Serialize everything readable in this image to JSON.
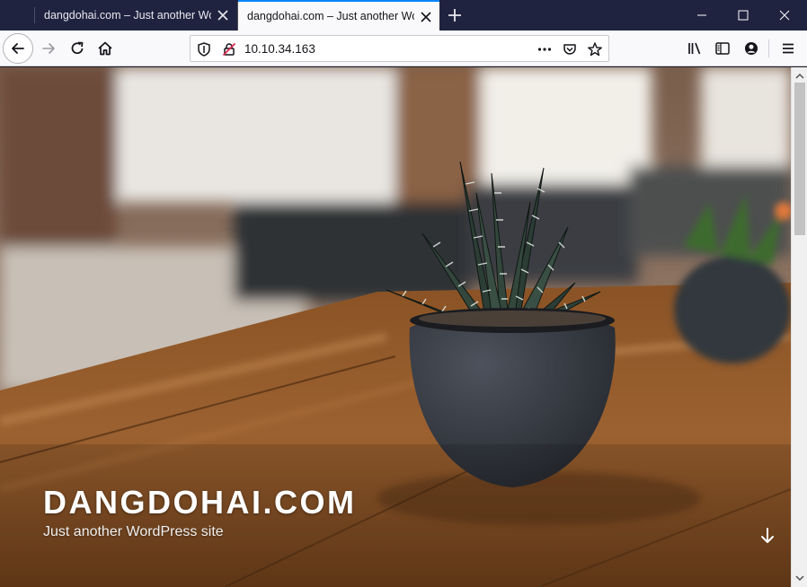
{
  "browser": {
    "tabs": [
      {
        "title": "dangdohai.com – Just another WordPress site",
        "active": false
      },
      {
        "title": "dangdohai.com – Just another WordPress site",
        "active": true
      }
    ],
    "url": "10.10.34.163",
    "icons": {
      "back": "arrow-left-icon",
      "forward": "arrow-right-icon",
      "reload": "reload-icon",
      "home": "home-icon",
      "tracking": "shield-icon",
      "insecure": "insecure-lock-icon",
      "page_actions": "more-dots-icon",
      "pocket": "pocket-icon",
      "bookmark": "star-icon",
      "library": "library-icon",
      "sidebar": "sidebar-icon",
      "account": "account-icon",
      "menu": "hamburger-menu-icon"
    },
    "accent": "#0a84ff"
  },
  "page": {
    "site_title": "DANGDOHAI.COM",
    "tagline": "Just another WordPress site"
  }
}
